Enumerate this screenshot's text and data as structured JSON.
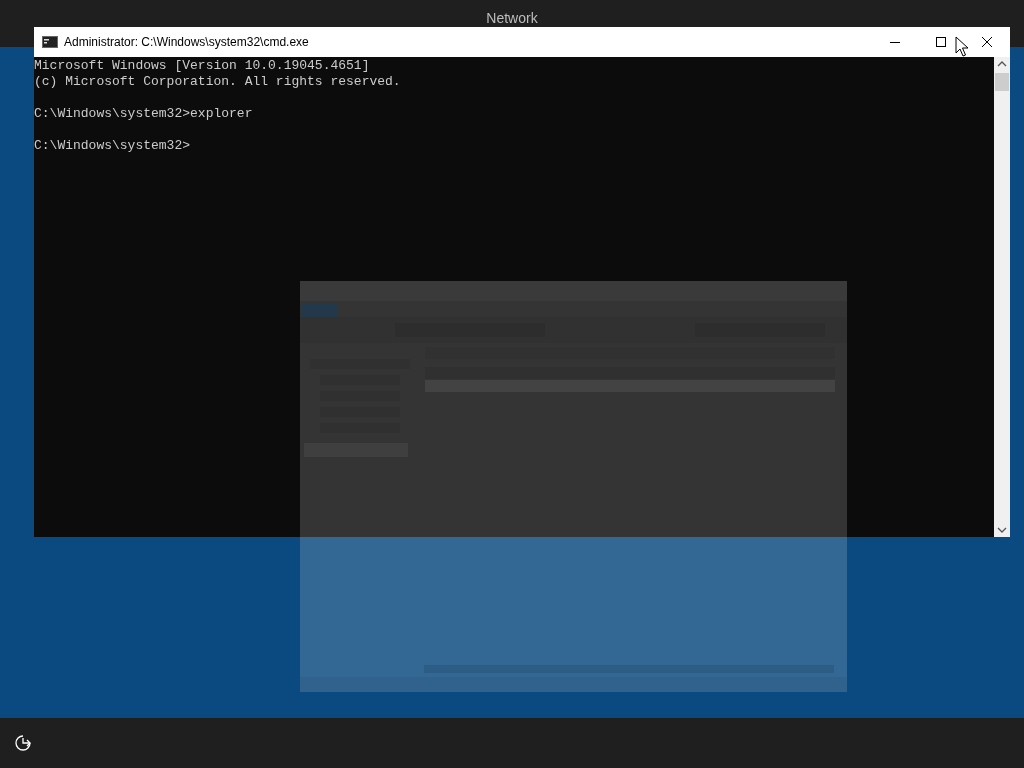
{
  "setup_header": {
    "title": "Network"
  },
  "console_window": {
    "title": "Administrator: C:\\Windows\\system32\\cmd.exe",
    "output_blocks": [
      [
        "Microsoft Windows [Version 10.0.19045.4651]",
        "(c) Microsoft Corporation. All rights reserved."
      ],
      [
        "C:\\Windows\\system32>explorer"
      ],
      [
        "C:\\Windows\\system32>"
      ]
    ]
  }
}
